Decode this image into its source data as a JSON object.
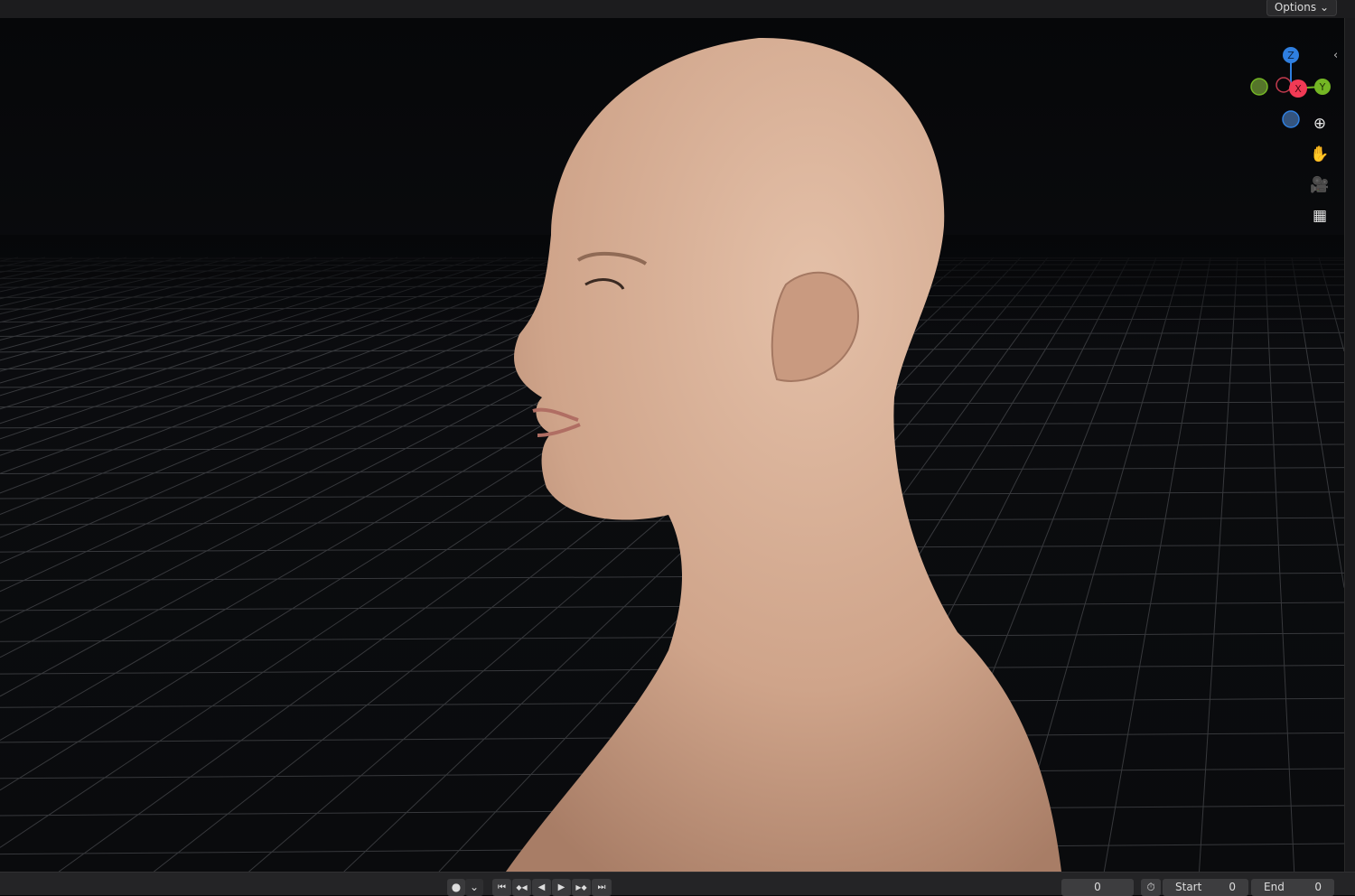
{
  "header": {
    "options_label": "Options ⌄"
  },
  "gizmo": {
    "axes": [
      {
        "label": "Z",
        "color": "#2f7fe0"
      },
      {
        "label": "Y",
        "color": "#74b624"
      },
      {
        "label": "X",
        "color": "#f13a55"
      }
    ]
  },
  "nav_icons": [
    "zoom-icon",
    "pan-hand-icon",
    "camera-icon",
    "perspective-grid-icon"
  ],
  "timeline": {
    "record_icon": "●",
    "record_dropdown": "⌄",
    "playback": [
      "⏮",
      "◆◀",
      "◀",
      "▶",
      "▶◆",
      "⏭"
    ],
    "current_frame": "0",
    "start_label": "Start",
    "start_value": "0",
    "end_label": "End",
    "end_value": "0"
  }
}
